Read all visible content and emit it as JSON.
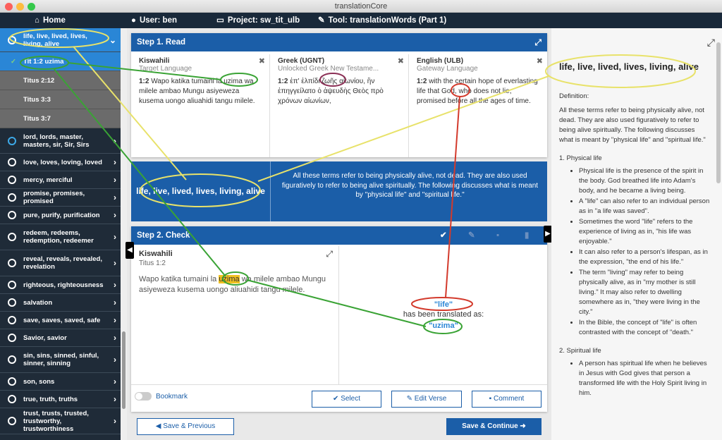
{
  "window": {
    "title": "translationCore"
  },
  "navbar": {
    "home": "Home",
    "user": "User: ben",
    "project": "Project: sw_tit_ulb",
    "tool": "Tool: translationWords (Part 1)"
  },
  "sidebar": {
    "active_group": "life, live, lived, lives, living, alive",
    "items": [
      {
        "label": "Tit 1:2 uzima"
      },
      {
        "label": "Titus 2:12"
      },
      {
        "label": "Titus 3:3"
      },
      {
        "label": "Titus 3:7"
      }
    ],
    "groups": [
      {
        "label": "lord, lords, master, masters, sir, Sir, Sirs"
      },
      {
        "label": "love, loves, loving, loved"
      },
      {
        "label": "mercy, merciful"
      },
      {
        "label": "promise, promises, promised"
      },
      {
        "label": "pure, purify, purification"
      },
      {
        "label": "redeem, redeems, redemption, redeemer"
      },
      {
        "label": "reveal, reveals, revealed, revelation"
      },
      {
        "label": "righteous, righteousness"
      },
      {
        "label": "salvation"
      },
      {
        "label": "save, saves, saved, safe"
      },
      {
        "label": "Savior, savior"
      },
      {
        "label": "sin, sins, sinned, sinful, sinner, sinning"
      },
      {
        "label": "son, sons"
      },
      {
        "label": "true, truth, truths"
      },
      {
        "label": "trust, trusts, trusted, trustworthy, trustworthiness"
      }
    ]
  },
  "step1": {
    "title": "Step 1. Read",
    "panes": [
      {
        "lang": "Kiswahili",
        "sub": "Target Language",
        "ref": "1:2",
        "text": "Wapo katika tumaini la uzima wa milele ambao Mungu asiyeweza kusema uongo aliuahidi tangu milele."
      },
      {
        "lang": "Greek (UGNT)",
        "sub": "Unlocked Greek New Testame...",
        "ref": "1:2",
        "text": "ἐπ' ἐλπίδι ζωῆς αἰωνίου, ἣν ἐπηγγείλατο ὁ ἀψευδὴς Θεὸς πρὸ χρόνων αἰωνίων,"
      },
      {
        "lang": "English (ULB)",
        "sub": "Gateway Language",
        "ref": "1:2",
        "text": "with the certain hope of everlasting life that God, who does not lie, promised before all the ages of time."
      }
    ]
  },
  "definition_bar": {
    "term": "life, live, lived, lives, living, alive",
    "summary": "All these terms refer to being physically alive, not dead. They are also used figuratively to refer to being alive spiritually. The following discusses what is meant by \"physical life\" and \"spiritual life.\""
  },
  "step2": {
    "title": "Step 2. Check",
    "lang": "Kiswahili",
    "ref": "Titus 1:2",
    "verse_before": "Wapo katika tumaini la ",
    "verse_highlight": "uzima",
    "verse_after": " wa milele ambao Mungu asiyeweza kusema uongo aliuahidi tangu milele.",
    "gl_word": "\"life\"",
    "translated_as": "has been translated as:",
    "target_word": "\"uzima\"",
    "bookmark": "Bookmark",
    "select": "Select",
    "edit_verse": "Edit Verse",
    "comment": "Comment"
  },
  "footer": {
    "save_previous": "Save & Previous",
    "save_continue": "Save & Continue"
  },
  "right_panel": {
    "title": "life, live, lived, lives, living, alive",
    "definition_label": "Definition:",
    "definition": "All these terms refer to being physically alive, not dead. They are also used figuratively to refer to being alive spiritually. The following discusses what is meant by \"physical life\" and \"spiritual life.\"",
    "sec1": "1. Physical life",
    "sec1_items": [
      "Physical life is the presence of the spirit in the body. God breathed life into Adam's body, and he became a living being.",
      "A \"life\" can also refer to an individual person as in \"a life was saved\".",
      "Sometimes the word \"life\" refers to the experience of living as in, \"his life was enjoyable.\"",
      "It can also refer to a person's lifespan, as in the expression, \"the end of his life.\"",
      "The term \"living\" may refer to being physically alive, as in \"my mother is still living.\" It may also refer to dwelling somewhere as in, \"they were living in the city.\"",
      "In the Bible, the concept of \"life\" is often contrasted with the concept of \"death.\""
    ],
    "sec2": "2. Spiritual life",
    "sec2_items": [
      "A person has spiritual life when he believes in Jesus with God gives that person a transformed life with the Holy Spirit living in him."
    ]
  },
  "colors": {
    "navbar": "#19293a",
    "sidebar": "#1f2b38",
    "accent": "#1b5ea8",
    "active": "#2a86d6",
    "annot_green": "#3aa335",
    "annot_yellow": "#e8e26a",
    "annot_red": "#d33a2c",
    "annot_purple": "#8b2f55"
  }
}
